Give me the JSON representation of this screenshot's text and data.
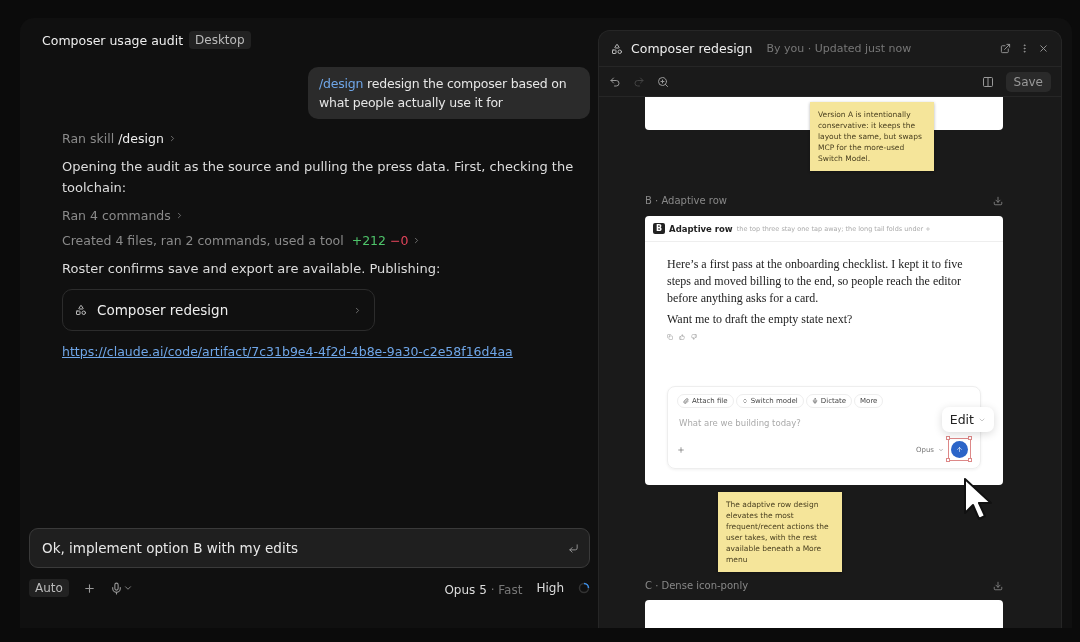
{
  "conversation": {
    "title": "Composer usage audit",
    "badge": "Desktop"
  },
  "user_message": {
    "command": "/design",
    "text": "redesign the composer based on what people actually use it for"
  },
  "transcript": [
    {
      "kind": "step",
      "text": "Ran skill",
      "emphasis": "/design"
    },
    {
      "kind": "text",
      "text": "Opening the audit as the source and pulling the press data. First, checking the toolchain:"
    },
    {
      "kind": "step",
      "text": "Ran 4 commands"
    },
    {
      "kind": "diff",
      "text": "Created 4 files, ran 2 commands, used a tool",
      "added": "+212",
      "removed": "−0"
    },
    {
      "kind": "text",
      "text": "Roster confirms save and export are available. Publishing:"
    },
    {
      "kind": "artifact",
      "text": "Composer redesign"
    },
    {
      "kind": "link",
      "text": "https://claude.ai/code/artifact/7c31b9e4-4f2d-4b8e-9a30-c2e58f16d4aa"
    }
  ],
  "composer": {
    "value": "Ok, implement option B with my edits",
    "mode": "Auto",
    "model": "Opus 5",
    "separator": "·",
    "speed": "Fast",
    "effort": "High"
  },
  "artifact": {
    "title": "Composer redesign",
    "meta": "By you · Updated just now",
    "save": "Save",
    "tools": [
      {
        "kind": "undo",
        "disabled": false
      },
      {
        "kind": "redo",
        "disabled": true
      },
      {
        "kind": "zoom",
        "disabled": false
      }
    ],
    "note_a": "Version A is intentionally conservative: it keeps the layout the same, but swaps MCP for the more-used Switch Model.",
    "section_b": {
      "label": "B · Adaptive row",
      "badge": "B",
      "title": "Adaptive row",
      "subtitle": "the top three stay one tap away; the long tail folds under +",
      "paragraphs": [
        "Here’s a first pass at the onboarding checklist. I kept it to five steps and moved billing to the end, so people reach the editor before anything asks for a card.",
        "Want me to draft the empty state next?"
      ],
      "chips": [
        {
          "kind": "attach",
          "label": "Attach file"
        },
        {
          "kind": "switch",
          "label": "Switch model"
        },
        {
          "kind": "dictate",
          "label": "Dictate"
        },
        {
          "kind": "more",
          "label": "More"
        }
      ],
      "placeholder": "What are we building today?",
      "model": "Opus",
      "edit_menu": "Edit"
    },
    "note_b": "The adaptive row design elevates the most frequent/recent actions the user takes, with the rest available beneath a More menu",
    "section_c": {
      "label": "C · Dense icon-ponly"
    }
  }
}
